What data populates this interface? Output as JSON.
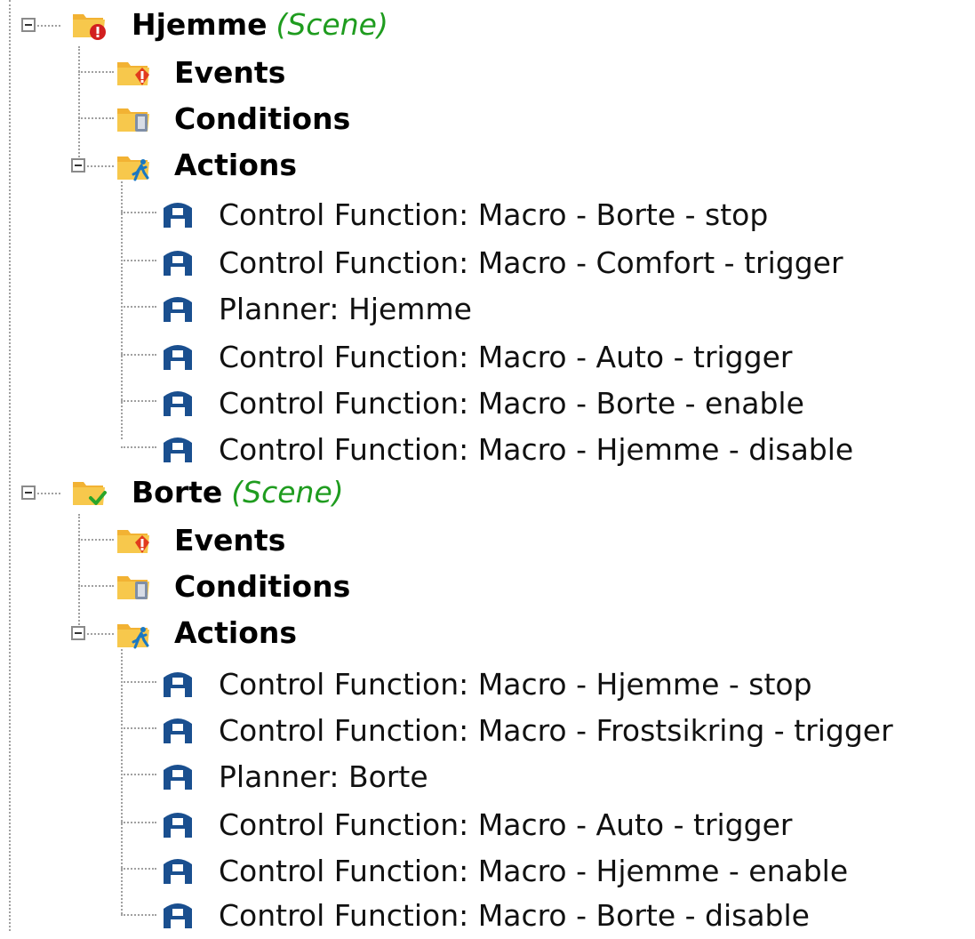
{
  "scenes": [
    {
      "name": "Hjemme",
      "tag": "(Scene)",
      "status": "error",
      "groups": {
        "events": "Events",
        "conditions": "Conditions",
        "actions": "Actions"
      },
      "actions": [
        "Control Function: Macro - Borte - stop",
        "Control Function: Macro - Comfort - trigger",
        "Planner: Hjemme",
        "Control Function: Macro - Auto - trigger",
        "Control Function: Macro - Borte - enable",
        "Control Function: Macro - Hjemme - disable"
      ]
    },
    {
      "name": "Borte",
      "tag": "(Scene)",
      "status": "ok",
      "groups": {
        "events": "Events",
        "conditions": "Conditions",
        "actions": "Actions"
      },
      "actions": [
        "Control Function: Macro - Hjemme - stop",
        "Control Function: Macro - Frostsikring - trigger",
        "Planner: Borte",
        "Control Function: Macro - Auto - trigger",
        "Control Function: Macro - Hjemme - enable",
        "Control Function: Macro - Borte - disable"
      ]
    }
  ],
  "icons": {
    "scene_error": "folder-error-icon",
    "scene_ok": "folder-check-icon",
    "events": "events-folder-icon",
    "conditions": "conditions-folder-icon",
    "actions": "actions-folder-icon",
    "action_item": "device-icon"
  },
  "colors": {
    "folder": "#f2b233",
    "scene_tag": "#1f9c1f",
    "device": "#1a4f8f",
    "error": "#d21f1f",
    "check": "#2aa52a"
  }
}
